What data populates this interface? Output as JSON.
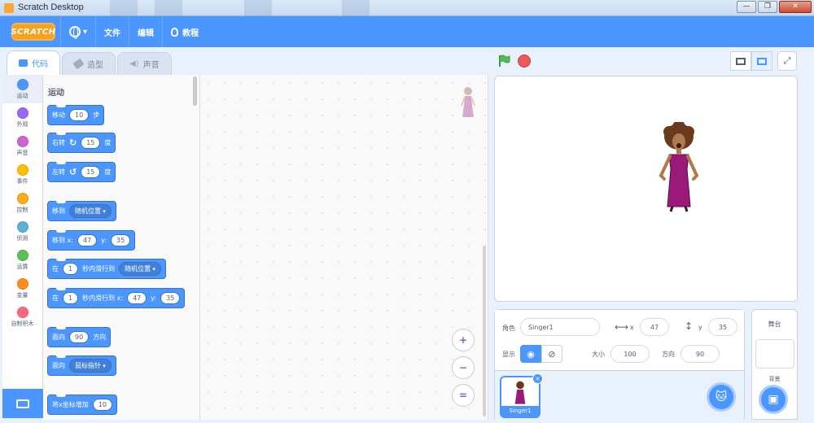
{
  "window": {
    "title": "Scratch Desktop",
    "buttons": [
      "—",
      "❐",
      "✕"
    ]
  },
  "menubar": {
    "logo_text": "SCRATCH",
    "file": "文件",
    "edit": "编辑",
    "tutorials": "教程"
  },
  "tabs": [
    {
      "label": "代码",
      "active": true
    },
    {
      "label": "造型",
      "active": false
    },
    {
      "label": "声音",
      "active": false
    }
  ],
  "categories": [
    {
      "label": "运动",
      "color": "#4c97ff"
    },
    {
      "label": "外观",
      "color": "#9966ff"
    },
    {
      "label": "声音",
      "color": "#cf63cf"
    },
    {
      "label": "事件",
      "color": "#ffbf00"
    },
    {
      "label": "控制",
      "color": "#ffab19"
    },
    {
      "label": "侦测",
      "color": "#5cb1d6"
    },
    {
      "label": "运算",
      "color": "#59c059"
    },
    {
      "label": "变量",
      "color": "#ff8c1a"
    },
    {
      "label": "自制积木",
      "color": "#ff6680"
    }
  ],
  "palette": {
    "title": "运动",
    "blocks": {
      "move": {
        "a": "移动",
        "value": "10",
        "b": "步"
      },
      "turn_right": {
        "a": "右转",
        "value": "15",
        "b": "度"
      },
      "turn_left": {
        "a": "左转",
        "value": "15",
        "b": "度"
      },
      "goto": {
        "a": "移到",
        "dropdown": "随机位置"
      },
      "goto_xy": {
        "a": "移到 x:",
        "x": "47",
        "b": "y:",
        "y": "35"
      },
      "glide": {
        "a": "在",
        "secs": "1",
        "b": "秒内滑行到",
        "dropdown": "随机位置"
      },
      "glide_xy": {
        "a": "在",
        "secs": "1",
        "b": "秒内滑行到 x:",
        "x": "47",
        "c": "y:",
        "y": "35"
      },
      "point_dir": {
        "a": "面向",
        "value": "90",
        "b": "方向"
      },
      "point_towards": {
        "a": "面向",
        "dropdown": "鼠标指针"
      },
      "change_x": {
        "a": "将x坐标增加",
        "value": "10"
      }
    }
  },
  "zoom": {
    "in": "+",
    "out": "−",
    "reset": "="
  },
  "sprite_info": {
    "sprite_label": "角色",
    "sprite_name": "Singer1",
    "x_label": "x",
    "x_value": "47",
    "y_label": "y",
    "y_value": "35",
    "show_label": "显示",
    "size_label": "大小",
    "size_value": "100",
    "direction_label": "方向",
    "direction_value": "90"
  },
  "sprites": [
    {
      "name": "Singer1",
      "selected": true
    }
  ],
  "stage_panel": {
    "title": "舞台",
    "backdrops_label": "背景"
  },
  "colors": {
    "accent": "#4c97ff",
    "motion": "#4c97ff",
    "stop": "#ec5959",
    "flag": "#4cbf56"
  }
}
